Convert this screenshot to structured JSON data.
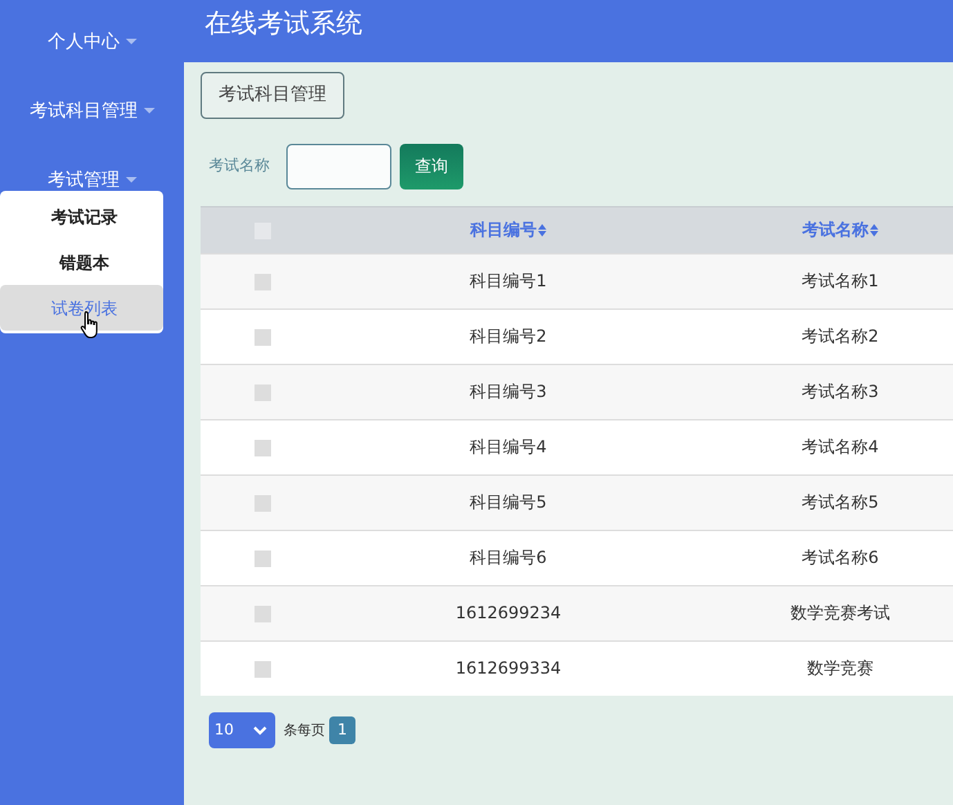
{
  "sidebar": {
    "items": [
      {
        "label": "个人中心"
      },
      {
        "label": "考试科目管理"
      },
      {
        "label": "考试管理",
        "expanded": true,
        "children": [
          {
            "label": "考试记录",
            "selected": false
          },
          {
            "label": "错题本",
            "selected": false
          },
          {
            "label": "试卷列表",
            "selected": true
          }
        ]
      }
    ]
  },
  "header": {
    "title": "在线考试系统"
  },
  "section_button": "考试科目管理",
  "search": {
    "label": "考试名称",
    "button": "查询"
  },
  "table": {
    "select_all_checked": false,
    "columns": [
      "科目编号",
      "考试名称"
    ],
    "rows": [
      {
        "checked": false,
        "cells": [
          "科目编号1",
          "考试名称1"
        ]
      },
      {
        "checked": false,
        "cells": [
          "科目编号2",
          "考试名称2"
        ]
      },
      {
        "checked": false,
        "cells": [
          "科目编号3",
          "考试名称3"
        ]
      },
      {
        "checked": false,
        "cells": [
          "科目编号4",
          "考试名称4"
        ]
      },
      {
        "checked": false,
        "cells": [
          "科目编号5",
          "考试名称5"
        ]
      },
      {
        "checked": false,
        "cells": [
          "科目编号6",
          "考试名称6"
        ]
      },
      {
        "checked": false,
        "cells": [
          "1612699234",
          "数学竞赛考试"
        ]
      },
      {
        "checked": false,
        "cells": [
          "1612699334",
          "数学竞赛"
        ]
      }
    ]
  },
  "pagination": {
    "page_size": "10",
    "per_page_label": "条每页",
    "pages": [
      {
        "label": "1",
        "selected": true
      }
    ]
  }
}
